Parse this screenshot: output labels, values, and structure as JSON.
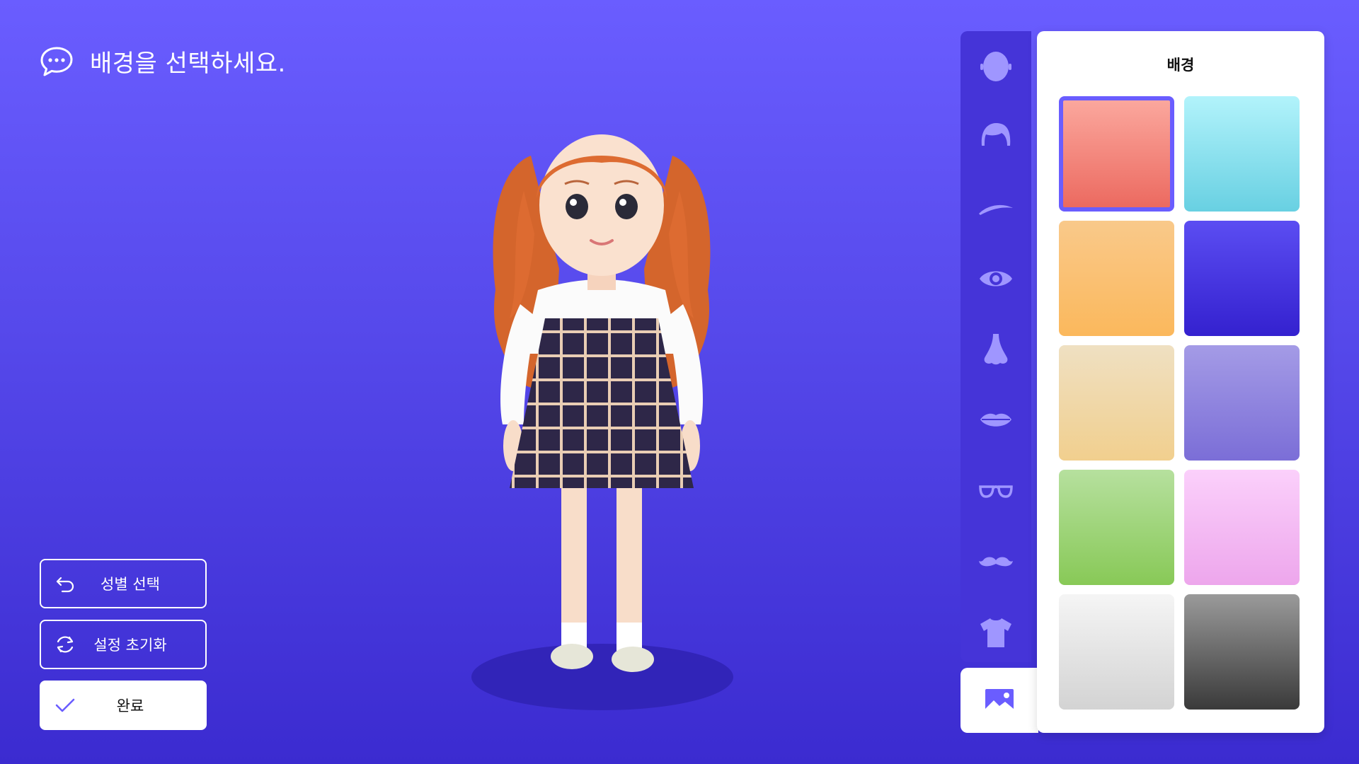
{
  "prompt": {
    "text": "배경을 선택하세요.",
    "icon": "chat-bubble-icon"
  },
  "actions": [
    {
      "label": "성별 선택",
      "icon": "undo-arrow-icon"
    },
    {
      "label": "설정 초기화",
      "icon": "refresh-icon"
    },
    {
      "label": "완료",
      "icon": "check-icon"
    }
  ],
  "categories": [
    {
      "name": "face-shape",
      "icon": "face-icon"
    },
    {
      "name": "hair",
      "icon": "hair-icon"
    },
    {
      "name": "eyebrows",
      "icon": "eyebrow-icon"
    },
    {
      "name": "eyes",
      "icon": "eye-icon"
    },
    {
      "name": "nose",
      "icon": "nose-icon"
    },
    {
      "name": "lips",
      "icon": "lips-icon"
    },
    {
      "name": "glasses",
      "icon": "glasses-icon"
    },
    {
      "name": "mustache",
      "icon": "mustache-icon"
    },
    {
      "name": "clothing",
      "icon": "tshirt-icon"
    },
    {
      "name": "background",
      "icon": "image-icon",
      "active": true
    }
  ],
  "panel": {
    "title": "배경",
    "selected_index": 0,
    "swatches": [
      {
        "from": "#fba79d",
        "to": "#ec6a60"
      },
      {
        "from": "#b2f3fb",
        "to": "#68d0e2"
      },
      {
        "from": "#f9c98a",
        "to": "#fbb85c"
      },
      {
        "from": "#5b4df2",
        "to": "#3421cf"
      },
      {
        "from": "#efe0c2",
        "to": "#f1cf8e"
      },
      {
        "from": "#a49be6",
        "to": "#7b6ed7"
      },
      {
        "from": "#b6e09e",
        "to": "#88c957"
      },
      {
        "from": "#fbd0fb",
        "to": "#eda6ec"
      },
      {
        "from": "#f5f5f5",
        "to": "#d3d3d3"
      },
      {
        "from": "#9a9a9a",
        "to": "#3a3a3a"
      }
    ]
  },
  "colors": {
    "accent": "#6a5dff",
    "rail": "#4534d8",
    "icon": "#9f96ff"
  }
}
